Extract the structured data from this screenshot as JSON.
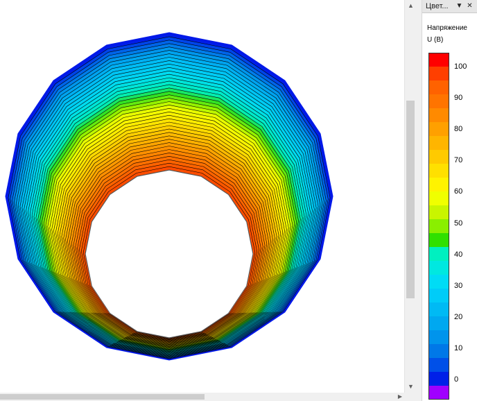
{
  "panel": {
    "title": "Цвет...",
    "dropdown_icon": "chevron-down-icon",
    "close_icon": "close-icon"
  },
  "legend": {
    "quantity": "Напряжение",
    "unit": "U (B)",
    "ticks": [
      "100",
      "90",
      "80",
      "70",
      "60",
      "50",
      "40",
      "30",
      "20",
      "10",
      "0"
    ],
    "tick_values": [
      100,
      90,
      80,
      70,
      60,
      50,
      40,
      30,
      20,
      10,
      0
    ],
    "range": [
      0,
      100
    ],
    "palette": [
      "#ff0000",
      "#ff3f00",
      "#ff6200",
      "#ff7400",
      "#ff8a00",
      "#ffa000",
      "#ffb500",
      "#ffca00",
      "#ffe000",
      "#fff300",
      "#f0ff00",
      "#c9f500",
      "#8aef00",
      "#30e000",
      "#00f0c0",
      "#00e8e0",
      "#00dcf5",
      "#00ccf8",
      "#00baf4",
      "#00a8f0",
      "#0094ec",
      "#0078e8",
      "#0050e8",
      "#0020e8",
      "#a000ff"
    ]
  },
  "plot": {
    "description_colors": {
      "inner": "#ff4500",
      "outer": "#0018e8",
      "contour_line": "#000000"
    },
    "contour_levels": 40
  }
}
